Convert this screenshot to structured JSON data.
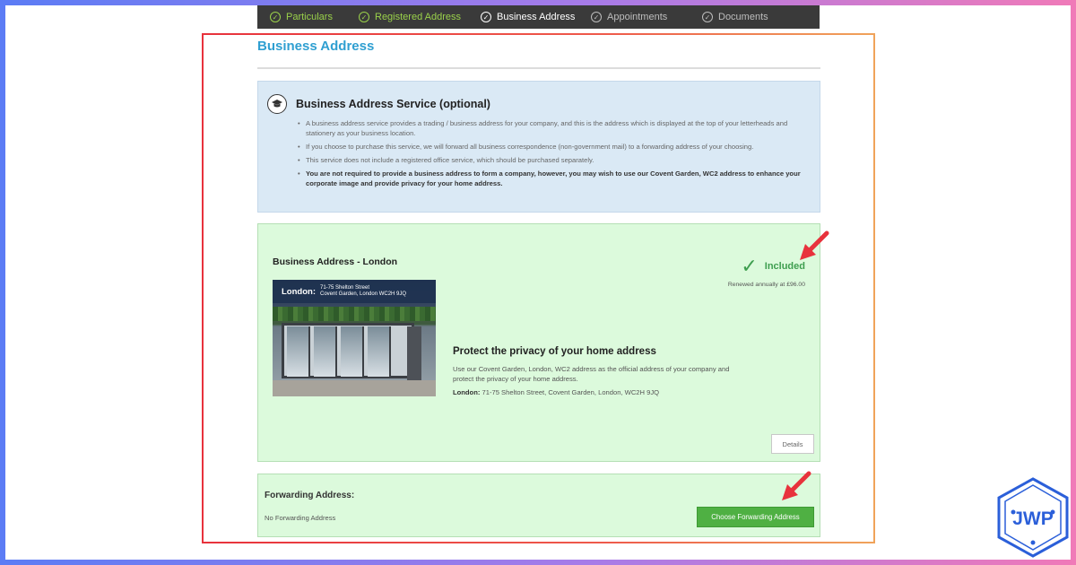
{
  "steps": [
    {
      "label": "Particulars",
      "state": "done"
    },
    {
      "label": "Registered Address",
      "state": "done"
    },
    {
      "label": "Business Address",
      "state": "active"
    },
    {
      "label": "Appointments",
      "state": "pending"
    },
    {
      "label": "Documents",
      "state": "pending"
    }
  ],
  "page": {
    "title": "Business Address"
  },
  "info": {
    "icon": "graduation-cap-icon",
    "title": "Business Address Service (optional)",
    "bullets": [
      "A business address service provides a trading / business address for your company, and this is the address which is displayed at the top of your letterheads and stationery as your business location.",
      "If you choose to purchase this service, we will forward all business correspondence (non-government mail) to a forwarding address of your choosing.",
      "This service does not include a registered office service, which should be purchased separately.",
      "You are not required to provide a business address to form a company, however, you may wish to use our Covent Garden, WC2 address to enhance your corporate image and provide privacy for your home address."
    ]
  },
  "business": {
    "title": "Business Address - London",
    "status": "Included",
    "renewal": "Renewed annually at £96.00",
    "photo": {
      "city": "London:",
      "line1": "71-75 Shelton Street",
      "line2": "Covent Garden, London WC2H 9JQ"
    },
    "promo_title": "Protect the privacy of your home address",
    "promo_text": "Use our Covent Garden, London, WC2 address as the official address of your company and protect the privacy of your home address.",
    "address_label": "London:",
    "address_value": "71-75 Shelton Street, Covent Garden, London, WC2H 9JQ",
    "details_label": "Details"
  },
  "forwarding": {
    "title": "Forwarding Address:",
    "value": "No Forwarding Address",
    "button_label": "Choose Forwarding Address"
  },
  "logo": {
    "text": "JWP"
  },
  "colors": {
    "accent_blue": "#2f9fd1",
    "success_green": "#3e9e4f",
    "button_green": "#4fb043",
    "highlight_red": "#e8323c"
  }
}
